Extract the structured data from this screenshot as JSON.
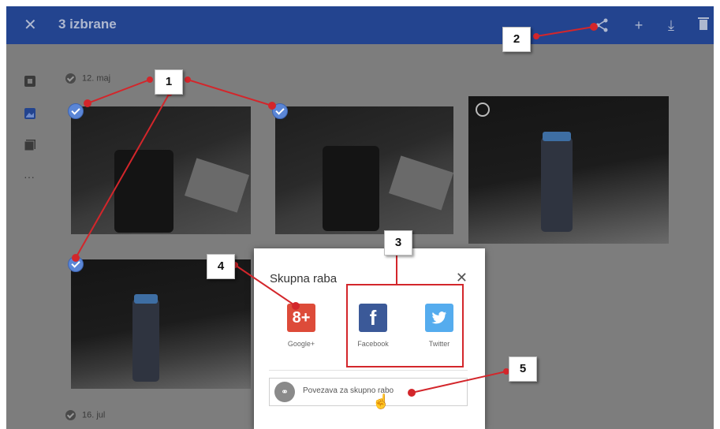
{
  "header": {
    "close_icon": "close-icon",
    "title": "3 izbrane",
    "actions": [
      "share-icon",
      "add-icon",
      "download-icon",
      "delete-icon"
    ]
  },
  "sidebar": {
    "items": [
      "photos-icon",
      "albums-icon",
      "shared-icon",
      "more-icon"
    ],
    "more_label": "···"
  },
  "groups": [
    {
      "date": "12. maj"
    },
    {
      "date": "16. jul"
    }
  ],
  "dialog": {
    "title": "Skupna raba",
    "services": [
      {
        "label": "Google+",
        "glyph": "8+",
        "color": "#dd4b39"
      },
      {
        "label": "Facebook",
        "glyph": "f",
        "color": "#3b5998"
      },
      {
        "label": "Twitter",
        "glyph": "🐦",
        "color": "#55acee"
      }
    ],
    "link_text": "Povezava za skupno rabo"
  },
  "callouts": [
    "1",
    "2",
    "3",
    "4",
    "5"
  ],
  "colors": {
    "header": "#23448f",
    "accent_red": "#d3262b",
    "selected_check": "#5b86d6"
  }
}
